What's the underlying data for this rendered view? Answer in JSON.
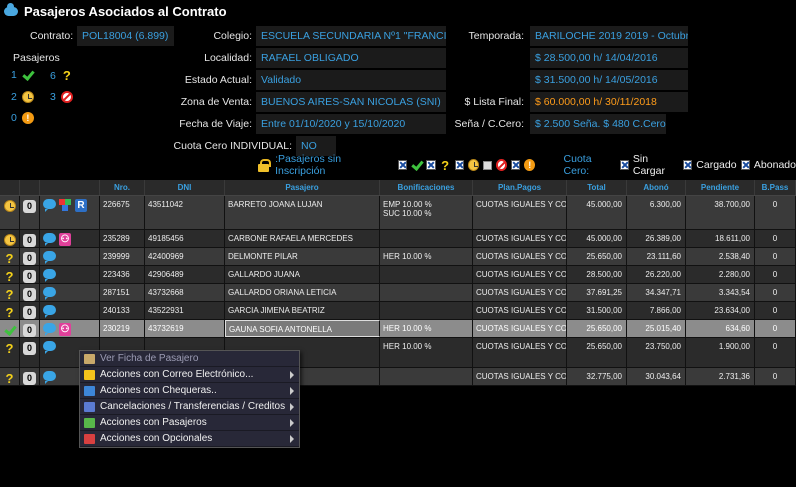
{
  "window": {
    "title": "Pasajeros Asociados al Contrato"
  },
  "contract": {
    "contrato_label": "Contrato:",
    "contrato": "POL18004 (6.899)",
    "colegio_label": "Colegio:",
    "colegio": "ESCUELA SECUNDARIA Nº1 \"FRANCISCO",
    "localidad_label": "Localidad:",
    "localidad": "RAFAEL OBLIGADO",
    "estado_label": "Estado Actual:",
    "estado": "Validado",
    "zona_label": "Zona de Venta:",
    "zona": "BUENOS AIRES-SAN NICOLAS (SNI)",
    "fecha_label": "Fecha de Viaje:",
    "fecha": "Entre 01/10/2020 y 15/10/2020",
    "cuota_label": "Cuota Cero INDIVIDUAL:",
    "cuota": "NO",
    "temporada_label": "Temporada:",
    "temporada": "BARILOCHE 2019 2019 - Octubre",
    "precio1": "$ 28.500,00 h/ 14/04/2016",
    "precio2": "$ 31.500,00 h/ 14/05/2016",
    "lista_label": "$ Lista Final:",
    "lista": "$ 60.000,00 h/ 30/11/2018",
    "sena_label": "Seña / C.Cero:",
    "sena": "$ 2.500 Seña. $ 480 C.Cero."
  },
  "pasajeros": {
    "title": "Pasajeros",
    "ok": "1",
    "pending": "6",
    "clock": "2",
    "banned": "3",
    "warn": "0"
  },
  "toolbar": {
    "sin_inscripcion": ":Pasajeros sin Inscripción",
    "cuota_cero": "Cuota Cero:",
    "sin_cargar": "Sin Cargar",
    "cargado": "Cargado",
    "abonado": "Abonado"
  },
  "grid": {
    "headers": [
      "",
      "",
      "",
      "Nro.",
      "DNI",
      "Pasajero",
      "Bonificaciones",
      "Plan.Pagos",
      "Total",
      "Abonó",
      "Pendiente",
      "B.Pass"
    ],
    "rows": [
      {
        "status": "clock",
        "nro": "226675",
        "dni": "43511042",
        "pasajero": "BARRETO JOANA LUJAN",
        "bonif": "EMP 10.00 %",
        "bonif2": "SUC 10.00 %",
        "plan": "CUOTAS IGUALES Y CON",
        "total": "45.000,00",
        "abono": "6.300,00",
        "pendiente": "38.700,00",
        "bpass": "0",
        "icons": "chat-blocks-r"
      },
      {
        "status": "clock",
        "nro": "235289",
        "dni": "49185456",
        "pasajero": "CARBONE RAFAELA MERCEDES",
        "bonif": "",
        "bonif2": "",
        "plan": "CUOTAS IGUALES Y CON",
        "total": "45.000,00",
        "abono": "26.389,00",
        "pendiente": "18.611,00",
        "bpass": "0",
        "icons": "chat-kid"
      },
      {
        "status": "q",
        "nro": "239999",
        "dni": "42400969",
        "pasajero": "DELMONTE PILAR",
        "bonif": "HER 10.00 %",
        "bonif2": "",
        "plan": "CUOTAS IGUALES Y CON",
        "total": "25.650,00",
        "abono": "23.111,60",
        "pendiente": "2.538,40",
        "bpass": "0",
        "icons": "chat"
      },
      {
        "status": "q",
        "nro": "223436",
        "dni": "42906489",
        "pasajero": "GALLARDO JUANA",
        "bonif": "",
        "bonif2": "",
        "plan": "CUOTAS IGUALES Y CON",
        "total": "28.500,00",
        "abono": "26.220,00",
        "pendiente": "2.280,00",
        "bpass": "0",
        "icons": "chat"
      },
      {
        "status": "q",
        "nro": "287151",
        "dni": "43732668",
        "pasajero": "GALLARDO ORIANA LETICIA",
        "bonif": "",
        "bonif2": "",
        "plan": "CUOTAS IGUALES Y CON",
        "total": "37.691,25",
        "abono": "34.347,71",
        "pendiente": "3.343,54",
        "bpass": "0",
        "icons": "chat"
      },
      {
        "status": "q",
        "nro": "240133",
        "dni": "43522931",
        "pasajero": "GARCIA JIMENA BEATRIZ",
        "bonif": "",
        "bonif2": "",
        "plan": "CUOTAS IGUALES Y CON",
        "total": "31.500,00",
        "abono": "7.866,00",
        "pendiente": "23.634,00",
        "bpass": "0",
        "icons": "chat"
      },
      {
        "status": "check",
        "nro": "230219",
        "dni": "43732619",
        "pasajero": "GAUNA SOFIA ANTONELLA",
        "bonif": "HER 10.00 %",
        "bonif2": "",
        "plan": "CUOTAS IGUALES Y CON",
        "total": "25.650,00",
        "abono": "25.015,40",
        "pendiente": "634,60",
        "bpass": "0",
        "icons": "chat-kid"
      },
      {
        "status": "q",
        "nro": "",
        "dni": "",
        "pasajero": "",
        "bonif": "HER 10.00 %",
        "bonif2": "",
        "plan": "CUOTAS IGUALES Y CON",
        "total": "25.650,00",
        "abono": "23.750,00",
        "pendiente": "1.900,00",
        "bpass": "0",
        "icons": "chat"
      },
      {
        "status": "q",
        "nro": "",
        "dni": "",
        "pasajero": "IELA",
        "bonif": "",
        "bonif2": "",
        "plan": "CUOTAS IGUALES Y CON",
        "total": "32.775,00",
        "abono": "30.043,64",
        "pendiente": "2.731,36",
        "bpass": "0",
        "icons": "chat"
      }
    ]
  },
  "context_menu": {
    "items": [
      {
        "label": "Ver Ficha de Pasajero",
        "disabled": true,
        "submenu": false,
        "color": "#c8a86a"
      },
      {
        "label": "Acciones con Correo Electrónico...",
        "disabled": false,
        "submenu": true,
        "color": "#f3c21c"
      },
      {
        "label": "Acciones con Chequeras..",
        "disabled": false,
        "submenu": true,
        "color": "#3d86d8"
      },
      {
        "label": "Cancelaciones / Transferencias / Creditos",
        "disabled": false,
        "submenu": true,
        "color": "#5b7bd1"
      },
      {
        "label": "Acciones con Pasajeros",
        "disabled": false,
        "submenu": true,
        "color": "#58b84a"
      },
      {
        "label": "Acciones con Opcionales",
        "disabled": false,
        "submenu": true,
        "color": "#d84040"
      }
    ]
  }
}
